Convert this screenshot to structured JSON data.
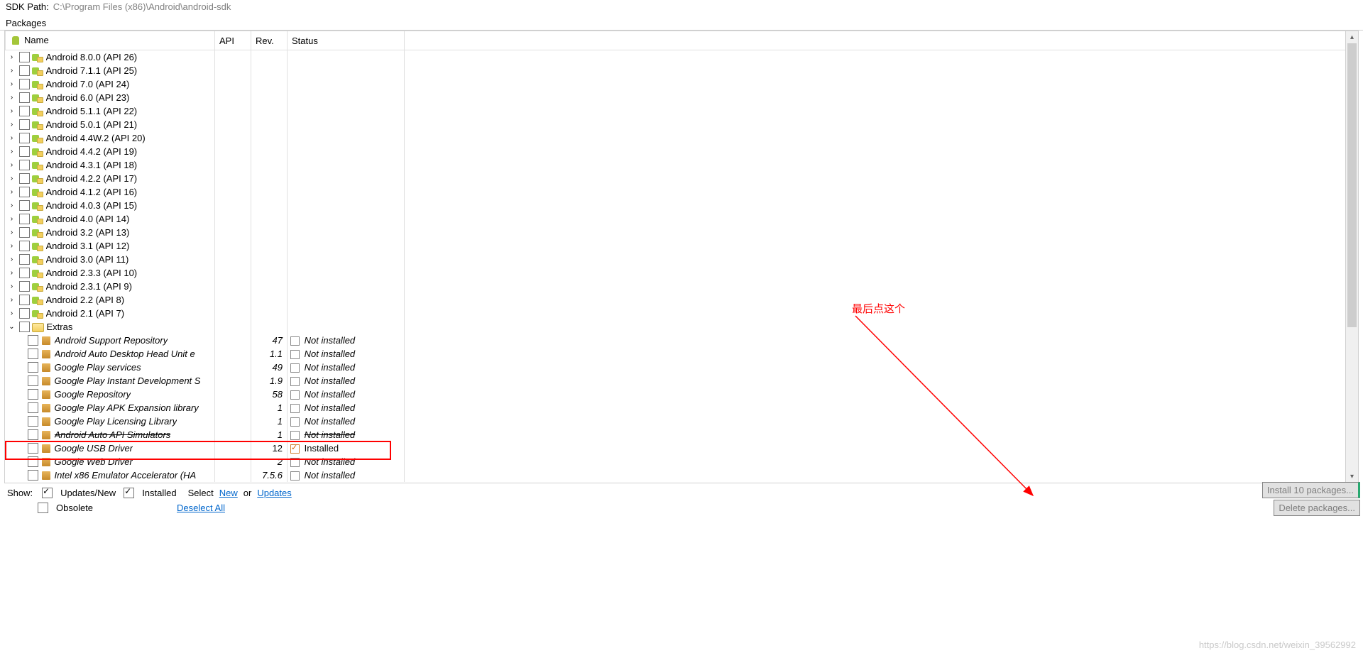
{
  "header": {
    "sdk_path_label": "SDK Path:",
    "sdk_path_value": "C:\\Program Files (x86)\\Android\\android-sdk"
  },
  "section_label": "Packages",
  "columns": {
    "name": "Name",
    "api": "API",
    "rev": "Rev.",
    "status": "Status"
  },
  "platform_rows": [
    {
      "name": "Android 8.0.0 (API 26)"
    },
    {
      "name": "Android 7.1.1 (API 25)"
    },
    {
      "name": "Android 7.0 (API 24)"
    },
    {
      "name": "Android 6.0 (API 23)"
    },
    {
      "name": "Android 5.1.1 (API 22)"
    },
    {
      "name": "Android 5.0.1 (API 21)"
    },
    {
      "name": "Android 4.4W.2 (API 20)"
    },
    {
      "name": "Android 4.4.2 (API 19)"
    },
    {
      "name": "Android 4.3.1 (API 18)"
    },
    {
      "name": "Android 4.2.2 (API 17)"
    },
    {
      "name": "Android 4.1.2 (API 16)"
    },
    {
      "name": "Android 4.0.3 (API 15)"
    },
    {
      "name": "Android 4.0 (API 14)"
    },
    {
      "name": "Android 3.2 (API 13)"
    },
    {
      "name": "Android 3.1 (API 12)"
    },
    {
      "name": "Android 3.0 (API 11)"
    },
    {
      "name": "Android 2.3.3 (API 10)"
    },
    {
      "name": "Android 2.3.1 (API 9)"
    },
    {
      "name": "Android 2.2 (API 8)"
    },
    {
      "name": "Android 2.1 (API 7)"
    }
  ],
  "extras_label": "Extras",
  "extras_rows": [
    {
      "name": "Android Support Repository",
      "rev": "47",
      "status": "Not installed"
    },
    {
      "name": "Android Auto Desktop Head Unit e",
      "rev": "1.1",
      "status": "Not installed"
    },
    {
      "name": "Google Play services",
      "rev": "49",
      "status": "Not installed"
    },
    {
      "name": "Google Play Instant Development S",
      "rev": "1.9",
      "status": "Not installed"
    },
    {
      "name": "Google Repository",
      "rev": "58",
      "status": "Not installed"
    },
    {
      "name": "Google Play APK Expansion library",
      "rev": "1",
      "status": "Not installed"
    },
    {
      "name": "Google Play Licensing Library",
      "rev": "1",
      "status": "Not installed"
    },
    {
      "name": "Android Auto API Simulators",
      "rev": "1",
      "status": "Not installed",
      "strike": true
    },
    {
      "name": "Google USB Driver",
      "rev": "12",
      "status": "Installed",
      "installed": true,
      "highlight": true
    },
    {
      "name": "Google Web Driver",
      "rev": "2",
      "status": "Not installed"
    },
    {
      "name": "Intel x86 Emulator Accelerator (HA",
      "rev": "7.5.6",
      "status": "Not installed"
    }
  ],
  "footer": {
    "show_label": "Show:",
    "updates_new": "Updates/New",
    "updates_new_checked": true,
    "installed": "Installed",
    "installed_checked": true,
    "select_label": "Select",
    "new_link": "New",
    "or_label": "or",
    "updates_link": "Updates",
    "obsolete": "Obsolete",
    "obsolete_checked": false,
    "deselect_all": "Deselect All",
    "install_btn": "Install 10 packages...",
    "delete_btn": "Delete packages..."
  },
  "annotation": "最后点这个",
  "watermark": "https://blog.csdn.net/weixin_39562992"
}
